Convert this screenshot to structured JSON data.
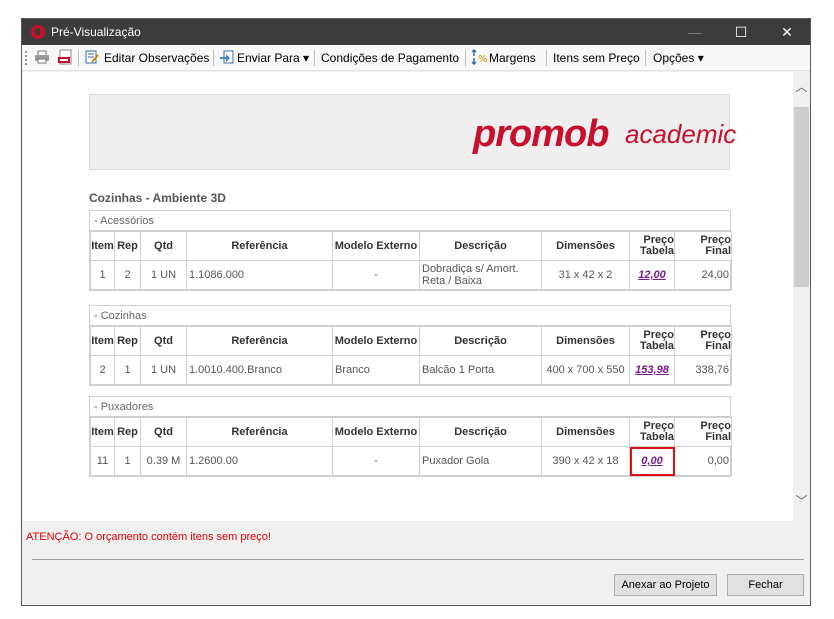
{
  "window": {
    "title": "Pré-Visualização"
  },
  "titlebar_buttons": {
    "minimize": "—",
    "maximize": "☐",
    "close": "✕"
  },
  "toolbar": {
    "items": [
      {
        "label": "Editar Observações",
        "icon": "edit-notes-icon"
      },
      {
        "label": "Enviar Para ▾",
        "icon": "send-icon"
      },
      {
        "label": "Condições de Pagamento",
        "icon": ""
      },
      {
        "label": "Margens",
        "icon": "percent-icon"
      },
      {
        "label": "Itens sem Preço",
        "icon": ""
      },
      {
        "label": "Opções ▾",
        "icon": ""
      }
    ]
  },
  "logo": {
    "brand": "promob",
    "edition": "academic",
    "color": "#c8102e"
  },
  "environment_title": "Cozinhas - Ambiente 3D",
  "columns": [
    "Item",
    "Rep",
    "Qtd",
    "Referência",
    "Modelo Externo",
    "Descrição",
    "Dimensões",
    "Preço Tabela",
    "Preço Final"
  ],
  "sections": [
    {
      "title": "- Acessórios",
      "rows": [
        {
          "item": "1",
          "rep": "2",
          "qtd": "1 UN",
          "ref": "1.1086.000",
          "modelo": "-",
          "descricao": "Dobradiça s/ Amort. Reta / Baixa",
          "dimensoes": "31 x 42 x 2",
          "preco_tabela": "12,00",
          "preco_final": "24,00"
        }
      ]
    },
    {
      "title": "- Cozinhas",
      "rows": [
        {
          "item": "2",
          "rep": "1",
          "qtd": "1 UN",
          "ref": "1.0010.400.Branco",
          "modelo": "Branco",
          "descricao": "Balcão 1 Porta",
          "dimensoes": "400 x 700 x 550",
          "preco_tabela": "153,98",
          "preco_final": "338,76"
        }
      ]
    },
    {
      "title": "- Puxadores",
      "rows": [
        {
          "item": "11",
          "rep": "1",
          "qtd": "0.39 M",
          "ref": "1.2600.00",
          "modelo": "-",
          "descricao": "Puxador Gola",
          "dimensoes": "390 x 42 x 18",
          "preco_tabela": "0,00",
          "preco_final": "0,00"
        }
      ]
    }
  ],
  "warning": "ATENÇÃO: O orçamento contém itens sem preço!",
  "buttons": {
    "attach": "Anexar ao Projeto",
    "close": "Fechar"
  },
  "scroll": {
    "up": "︿",
    "down": "﹀"
  }
}
